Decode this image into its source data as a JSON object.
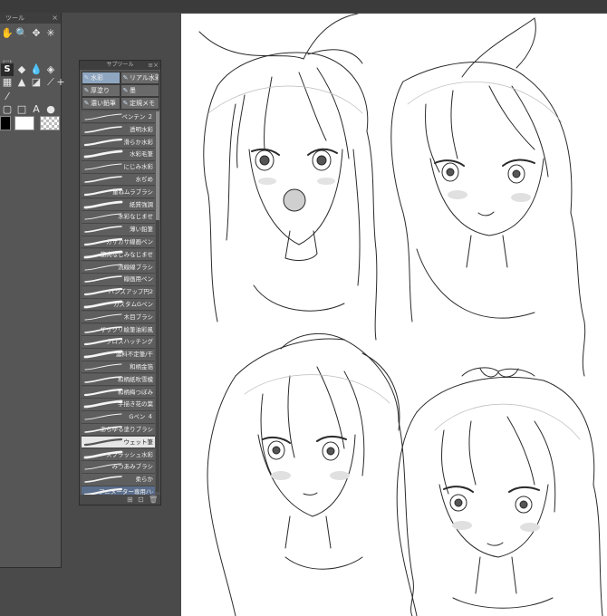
{
  "tool_panel": {
    "title": "ツール",
    "close_glyph": "×",
    "tools": [
      {
        "icon": "hand-icon",
        "glyph": "✋"
      },
      {
        "icon": "zoom-icon",
        "glyph": "🔍"
      },
      {
        "icon": "move-icon",
        "glyph": "✥"
      },
      {
        "icon": "magic-wand-icon",
        "glyph": "✳"
      },
      {
        "icon": "selection-icon",
        "glyph": "⬚"
      },
      {
        "icon": "pen-icon",
        "glyph": "S",
        "active": true
      },
      {
        "icon": "fill-icon",
        "glyph": "◆"
      },
      {
        "icon": "blend-icon",
        "glyph": "💧"
      },
      {
        "icon": "eraser-icon",
        "glyph": "◈"
      },
      {
        "icon": "decoration-icon",
        "glyph": "▦"
      },
      {
        "icon": "ink-bottle-icon",
        "glyph": "▲"
      },
      {
        "icon": "gradient-icon",
        "glyph": "◪"
      },
      {
        "icon": "ruler-icon",
        "glyph": "⟋"
      },
      {
        "icon": "ruler-plus-icon",
        "glyph": "+"
      },
      {
        "icon": "eyedropper-icon",
        "glyph": "⁄"
      },
      {
        "icon": "frame-icon",
        "glyph": "▢"
      },
      {
        "icon": "figure-icon",
        "glyph": "□"
      },
      {
        "icon": "text-icon",
        "glyph": "A"
      },
      {
        "icon": "object-icon",
        "glyph": "●"
      }
    ],
    "colors": {
      "main": "#000000",
      "sub": "#ffffff"
    }
  },
  "subtool_panel": {
    "title": "サブツール",
    "groups": [
      {
        "icon": "watercolor-icon",
        "label": "水彩",
        "active": true
      },
      {
        "icon": "real-watercolor-icon",
        "label": "リアル水彩"
      },
      {
        "icon": "thick-paint-icon",
        "label": "厚塗り"
      },
      {
        "icon": "ink-icon",
        "label": "墨"
      },
      {
        "icon": "dark-pencil-icon",
        "label": "濃い鉛筆"
      },
      {
        "icon": "fixed-icon",
        "label": "定規メモ"
      }
    ],
    "brushes": [
      "ペンテン ２",
      "透明水彩",
      "滑らか水彩",
      "水彩毛筆",
      "にじみ水彩",
      "水ぢめ",
      "重ねムラブラシ",
      "紙質強調",
      "水彩なじませ",
      "薄い鉛筆",
      "カサカサ線画ペン",
      "筋肉なじみなじませ",
      "流線線ブラシ",
      "線画用ペン",
      "ハンズアップ円2",
      "カスタムGペン",
      "木目ブラシ",
      "ザックリ絵筆油彩風",
      "クロスハッチング",
      "濃料不定筆/干",
      "和柄金箔",
      "和柄紙吹雪模",
      "和柄梅つぼみ",
      "手描き花の葉",
      "Gペン ４",
      "あらゆる塗りブラシ",
      "ウェット筆",
      "スプラッシュ水彩",
      "みつあみブラシ",
      "柔らか",
      "アニメーター専用ハイパ系鉛"
    ],
    "selected_brush": 26,
    "highlighted_brush": 30,
    "footer": [
      "⊞",
      "⊡",
      "🗑"
    ]
  }
}
